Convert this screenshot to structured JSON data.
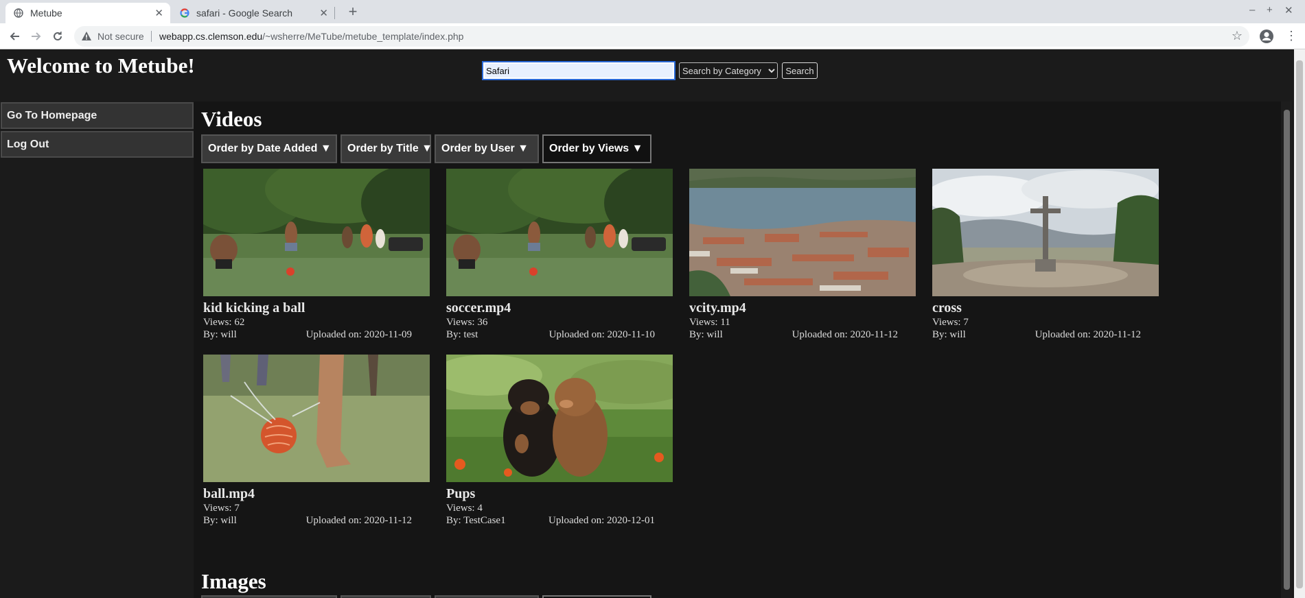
{
  "browser": {
    "tabs": [
      {
        "title": "Metube",
        "active": true
      },
      {
        "title": "safari - Google Search",
        "active": false
      }
    ],
    "address": {
      "security_label": "Not secure",
      "host": "webapp.cs.clemson.edu",
      "path": "/~wsherre/MeTube/metube_template/index.php"
    }
  },
  "header": {
    "title": "Welcome to Metube!",
    "search_value": "Safari",
    "category_selected": "Search by Category",
    "search_button": "Search"
  },
  "sidebar": {
    "items": [
      {
        "label": "Go To Homepage"
      },
      {
        "label": "Log Out"
      }
    ]
  },
  "videos": {
    "heading": "Videos",
    "order_buttons": [
      {
        "label": "Order by Date Added ▼"
      },
      {
        "label": "Order by Title ▼"
      },
      {
        "label": "Order by User ▼"
      },
      {
        "label": "Order by Views ▼",
        "active": true
      }
    ],
    "items": [
      {
        "title": "kid kicking a ball",
        "views": "Views: 62",
        "by": "By: will",
        "uploaded": "Uploaded on: 2020-11-09",
        "thumb": "soccer-kids"
      },
      {
        "title": "soccer.mp4",
        "views": "Views: 36",
        "by": "By: test",
        "uploaded": "Uploaded on: 2020-11-10",
        "thumb": "soccer-kids"
      },
      {
        "title": "vcity.mp4",
        "views": "Views: 11",
        "by": "By: will",
        "uploaded": "Uploaded on: 2020-11-12",
        "thumb": "aerial-lake-town"
      },
      {
        "title": "cross",
        "views": "Views: 7",
        "by": "By: will",
        "uploaded": "Uploaded on: 2020-11-12",
        "thumb": "hilltop-cross"
      },
      {
        "title": "ball.mp4",
        "views": "Views: 7",
        "by": "By: will",
        "uploaded": "Uploaded on: 2020-11-12",
        "thumb": "ball-splash"
      },
      {
        "title": "Pups",
        "views": "Views: 4",
        "by": "By: TestCase1",
        "uploaded": "Uploaded on: 2020-12-01",
        "thumb": "two-puppies"
      }
    ]
  },
  "images": {
    "heading": "Images"
  },
  "colors": {
    "page_bg": "#151515",
    "header_bg": "#1b1b1b",
    "sidebar_button_bg": "#333333",
    "accent_focus": "#2a6ad8"
  }
}
